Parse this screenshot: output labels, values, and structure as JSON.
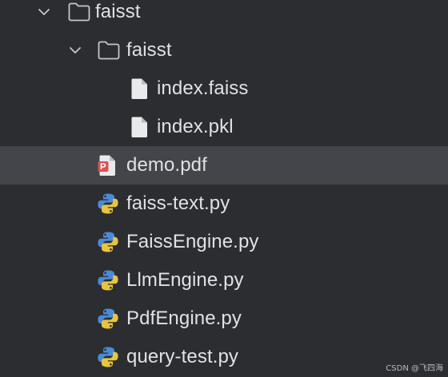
{
  "tree": {
    "items": [
      {
        "label": "faisst",
        "kind": "folder",
        "expanded": true,
        "depth": 0,
        "selected": false
      },
      {
        "label": "faisst",
        "kind": "folder",
        "expanded": true,
        "depth": 1,
        "selected": false
      },
      {
        "label": "index.faiss",
        "kind": "file",
        "depth": 2,
        "selected": false
      },
      {
        "label": "index.pkl",
        "kind": "file",
        "depth": 2,
        "selected": false
      },
      {
        "label": "demo.pdf",
        "kind": "pdf",
        "depth": 1,
        "selected": true
      },
      {
        "label": "faiss-text.py",
        "kind": "python",
        "depth": 1,
        "selected": false
      },
      {
        "label": "FaissEngine.py",
        "kind": "python",
        "depth": 1,
        "selected": false
      },
      {
        "label": "LlmEngine.py",
        "kind": "python",
        "depth": 1,
        "selected": false
      },
      {
        "label": "PdfEngine.py",
        "kind": "python",
        "depth": 1,
        "selected": false
      },
      {
        "label": "query-test.py",
        "kind": "python",
        "depth": 1,
        "selected": false
      }
    ]
  },
  "watermark": "CSDN @飞四海",
  "colors": {
    "background": "#2b2d30",
    "selected_row": "#43454a",
    "text": "#dfe1e5",
    "icon_outline": "#c3c6cc",
    "pdf_red": "#d9534f",
    "python_blue": "#4a8ad6",
    "python_yellow": "#e8c440"
  }
}
